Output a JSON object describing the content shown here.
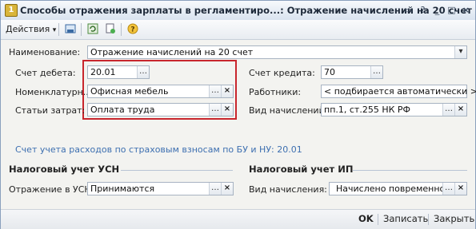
{
  "window": {
    "title": "Способы отражения зарплаты в регламентиро...: Отражение начислений на 20 счет",
    "icon": "1c-app-icon",
    "controls": [
      "restore-icon",
      "help-icon",
      "minimize-icon",
      "maximize-icon",
      "close-icon"
    ]
  },
  "toolbar": {
    "actions_label": "Действия",
    "actions_arrow": "▾",
    "icons": [
      "save-icon",
      "refresh-icon",
      "copy-icon",
      "help-icon"
    ]
  },
  "form": {
    "name_label": "Наименование:",
    "name_value": "Отражение начислений на 20 счет",
    "debit_label": "Счет дебета:",
    "debit_value": "20.01",
    "credit_label": "Счет кредита:",
    "credit_value": "70",
    "nomenclature_label": "Номенклатурн...",
    "nomenclature_value": "Офисная мебель",
    "workers_label": "Работники:",
    "workers_value": "< подбирается автоматически >",
    "cost_label": "Статьи затрат:",
    "cost_value": "Оплата труда",
    "accrual_type_label": "Вид начислений:",
    "accrual_type_value": "пп.1, ст.255 НК РФ",
    "insurance_note": "Счет учета расходов по страховым взносам по БУ и НУ: 20.01"
  },
  "usn": {
    "title": "Налоговый учет УСН",
    "reflection_label": "Отражение в УСН:",
    "reflection_value": "Принимаются"
  },
  "ip": {
    "title": "Налоговый учет ИП",
    "accrual_label": "Вид начисления:",
    "accrual_value": "Начислено повременно"
  },
  "buttons": {
    "ok": "OK",
    "write": "Записать",
    "close": "Закрыть"
  },
  "colors": {
    "highlight_border": "#c8262d",
    "link_text": "#3d6fb0"
  }
}
